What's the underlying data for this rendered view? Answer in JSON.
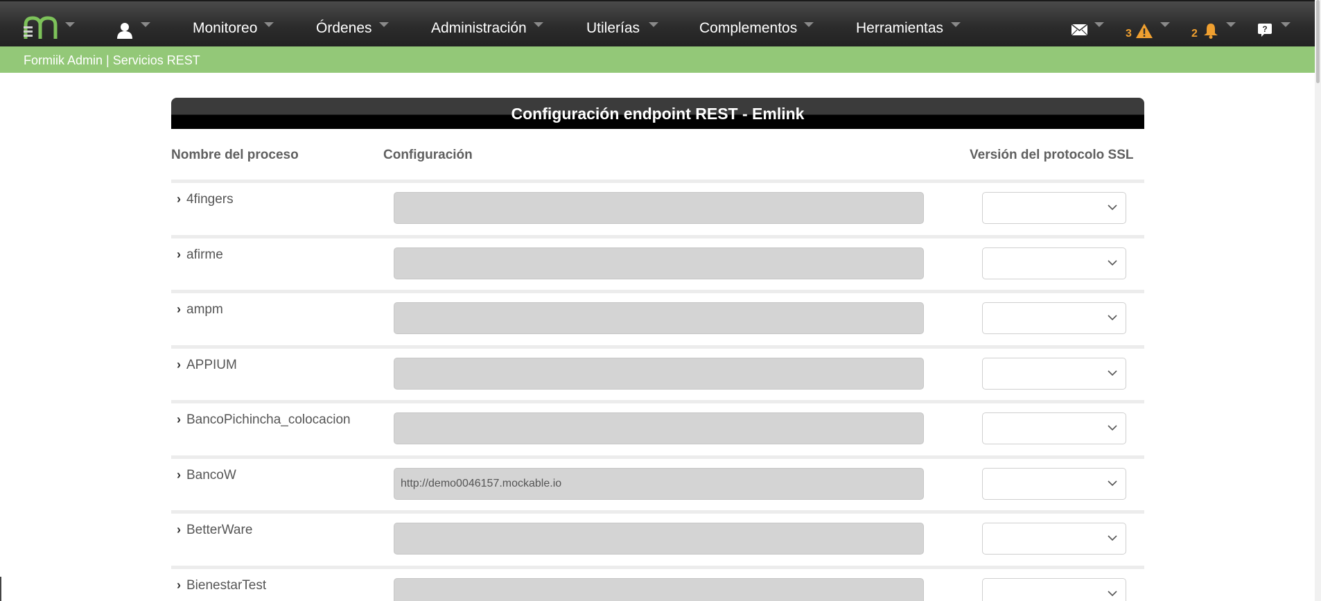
{
  "nav": {
    "items": [
      {
        "label": "Monitoreo"
      },
      {
        "label": "Órdenes"
      },
      {
        "label": "Administración"
      },
      {
        "label": "Utilerías"
      },
      {
        "label": "Complementos"
      },
      {
        "label": "Herramientas"
      }
    ],
    "warning_count": "3",
    "notification_count": "2",
    "icons": [
      "logo-icon",
      "user-icon",
      "mail-icon",
      "warning-icon",
      "bell-icon",
      "help-icon"
    ]
  },
  "breadcrumb": "Formiik Admin | Servicios REST",
  "panel": {
    "title": "Configuración endpoint REST - Emlink",
    "columns": [
      "Nombre del proceso",
      "Configuración",
      "Versión del protocolo SSL"
    ],
    "rows": [
      {
        "name": "4fingers",
        "config": ""
      },
      {
        "name": "afirme",
        "config": ""
      },
      {
        "name": "ampm",
        "config": ""
      },
      {
        "name": "APPIUM",
        "config": ""
      },
      {
        "name": "BancoPichincha_colocacion",
        "config": ""
      },
      {
        "name": "BancoW",
        "config": "http://demo0046157.mockable.io"
      },
      {
        "name": "BetterWare",
        "config": ""
      },
      {
        "name": "BienestarTest",
        "config": ""
      }
    ]
  },
  "colors": {
    "nav_bg": "#2c2c2c",
    "breadcrumb_bg": "#93c878",
    "logo_green": "#7dc25a",
    "badge_orange": "#f0a030",
    "field_bg": "#d4d4d4"
  }
}
